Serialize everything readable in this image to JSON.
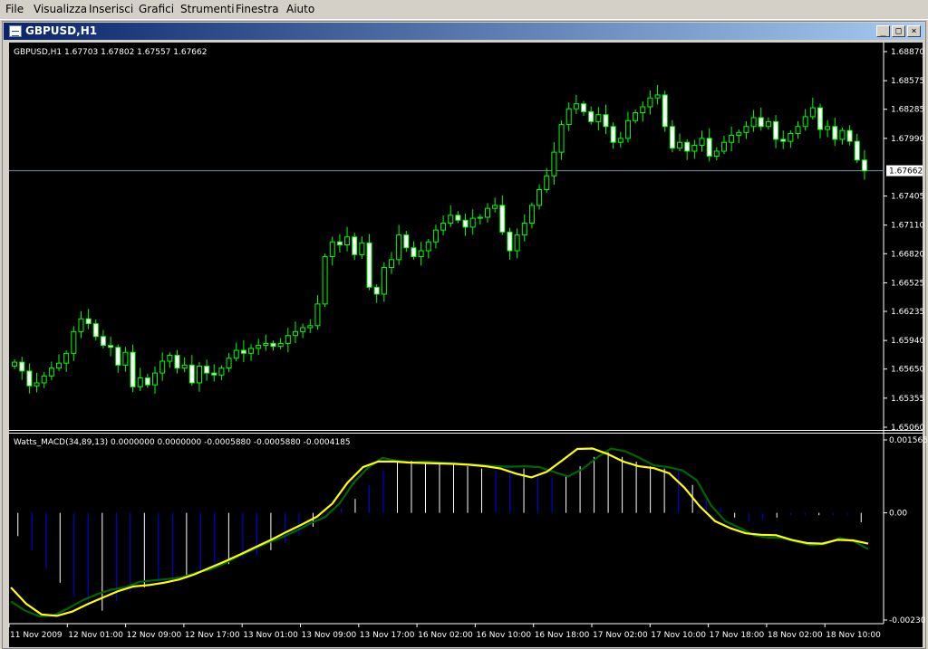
{
  "menu": [
    "File",
    "Visualizza",
    "Inserisci",
    "Grafici",
    "Strumenti",
    "Finestra",
    "Aiuto"
  ],
  "window": {
    "title": "GBPUSD,H1",
    "minimize": "_",
    "restore": "□",
    "close": "×"
  },
  "colors": {
    "background": "#000000",
    "candle_bull_fill": "#000000",
    "candle_bear_fill": "#ffffff",
    "candle_outline": "#00ff00",
    "grid_line": "#7f8ca8",
    "macd_line": "#006400",
    "signal_line": "#ffff00",
    "histogram_positive": "#ffffff",
    "histogram_negative": "#0000ff"
  },
  "chart_data": [
    {
      "type": "candlestick",
      "title": "GBPUSD,H1  1.67703 1.67802 1.67557 1.67662",
      "symbol": "GBPUSD",
      "timeframe": "H1",
      "last_ohlc": {
        "open": 1.67703,
        "high": 1.67802,
        "low": 1.67557,
        "close": 1.67662
      },
      "current_price_label": "1.67662",
      "y_ticks": [
        "1.68870",
        "1.68575",
        "1.68285",
        "1.67990",
        "1.67405",
        "1.67110",
        "1.66820",
        "1.66525",
        "1.66235",
        "1.65940",
        "1.65650",
        "1.65355",
        "1.65060"
      ],
      "ylim": [
        1.6506,
        1.6887
      ],
      "x_ticks": [
        "11 Nov 2009",
        "12 Nov 01:00",
        "12 Nov 09:00",
        "12 Nov 17:00",
        "13 Nov 01:00",
        "13 Nov 09:00",
        "13 Nov 17:00",
        "16 Nov 02:00",
        "16 Nov 10:00",
        "16 Nov 18:00",
        "17 Nov 02:00",
        "17 Nov 10:00",
        "17 Nov 18:00",
        "18 Nov 02:00",
        "18 Nov 10:00"
      ],
      "close_series": [
        1.6572,
        1.6563,
        1.6548,
        1.6551,
        1.6558,
        1.6566,
        1.6571,
        1.6581,
        1.6603,
        1.6616,
        1.6611,
        1.6598,
        1.6589,
        1.6587,
        1.6569,
        1.6582,
        1.6547,
        1.6556,
        1.6549,
        1.6561,
        1.6573,
        1.6579,
        1.6566,
        1.6569,
        1.6551,
        1.6568,
        1.6561,
        1.6559,
        1.6566,
        1.6576,
        1.6584,
        1.6581,
        1.6586,
        1.6589,
        1.6591,
        1.6588,
        1.6591,
        1.6599,
        1.6603,
        1.6607,
        1.6609,
        1.6631,
        1.6679,
        1.6694,
        1.6691,
        1.6699,
        1.6681,
        1.6693,
        1.6648,
        1.6641,
        1.6668,
        1.6676,
        1.6701,
        1.6688,
        1.6679,
        1.6685,
        1.6694,
        1.6706,
        1.6713,
        1.6721,
        1.6716,
        1.6709,
        1.6718,
        1.6719,
        1.6728,
        1.6731,
        1.6704,
        1.6685,
        1.6701,
        1.6713,
        1.6731,
        1.6747,
        1.6761,
        1.6785,
        1.6813,
        1.6829,
        1.6834,
        1.6826,
        1.6816,
        1.6823,
        1.6811,
        1.6795,
        1.6799,
        1.6817,
        1.6825,
        1.6831,
        1.684,
        1.6843,
        1.6811,
        1.6789,
        1.6795,
        1.6786,
        1.6792,
        1.6799,
        1.6781,
        1.6786,
        1.6795,
        1.6802,
        1.6805,
        1.6811,
        1.682,
        1.6811,
        1.6816,
        1.6798,
        1.6796,
        1.6804,
        1.6811,
        1.6821,
        1.683,
        1.6808,
        1.6811,
        1.6798,
        1.6807,
        1.6796,
        1.6777,
        1.6766
      ]
    },
    {
      "type": "line",
      "title": "Watts_MACD(34,89,13) 0.0000000 0.0000000 -0.0005880 -0.0005880 -0.0004185",
      "y_ticks": [
        "0.001565",
        "0.00",
        "-0.00230"
      ],
      "ylim": [
        -0.0023,
        0.001565
      ],
      "series": [
        {
          "name": "Watts_MACD",
          "color": "#006400",
          "values": [
            -0.0019,
            -0.0021,
            -0.00222,
            -0.0022,
            -0.00205,
            -0.00188,
            -0.00175,
            -0.00165,
            -0.0016,
            -0.00148,
            -0.00145,
            -0.00142,
            -0.00138,
            -0.00128,
            -0.00121,
            -0.00108,
            -0.00092,
            -0.00078,
            -0.00064,
            -0.00052,
            -0.00038,
            -0.00022,
            -9e-05,
            0.0002,
            0.00065,
            0.00097,
            0.00118,
            0.00112,
            0.00108,
            0.0011,
            0.00108,
            0.00106,
            0.00104,
            0.00102,
            0.001,
            0.00099,
            0.001,
            0.00098,
            0.00088,
            0.00078,
            0.00094,
            0.00118,
            0.00138,
            0.00132,
            0.00118,
            0.00102,
            0.00098,
            0.00091,
            0.0007,
            0.00016,
            -0.00018,
            -0.00032,
            -0.00048,
            -0.00053,
            -0.00054,
            -0.00062,
            -0.00069,
            -0.00067,
            -0.00054,
            -0.00061,
            -0.00078
          ]
        },
        {
          "name": "Signal",
          "color": "#ffff00",
          "values": [
            -0.0016,
            -0.00195,
            -0.00218,
            -0.00221,
            -0.00212,
            -0.00196,
            -0.00182,
            -0.00168,
            -0.00158,
            -0.00155,
            -0.0015,
            -0.00143,
            -0.00132,
            -0.00118,
            -0.00104,
            -0.00089,
            -0.00073,
            -0.00058,
            -0.00041,
            -0.00025,
            -8e-05,
            0.0002,
            0.00065,
            0.00098,
            0.0011,
            0.0011,
            0.00108,
            0.00107,
            0.00106,
            0.00105,
            0.00103,
            0.001,
            0.00095,
            0.00084,
            0.00076,
            0.00088,
            0.00112,
            0.00137,
            0.00138,
            0.00126,
            0.0011,
            0.001,
            0.00096,
            0.00085,
            0.00054,
            0.00014,
            -0.00018,
            -0.00033,
            -0.00044,
            -0.00047,
            -0.00048,
            -0.00058,
            -0.00065,
            -0.00066,
            -0.00058,
            -0.00059,
            -0.00066
          ]
        }
      ],
      "histogram": {
        "positive_color": "#ffffff",
        "negative_color": "#0000ff",
        "values": [
          -0.0005,
          -0.0008,
          -0.0012,
          -0.0015,
          -0.0018,
          -0.002,
          -0.0021,
          -0.0019,
          -0.0017,
          -0.0016,
          -0.0015,
          -0.00145,
          -0.0014,
          -0.0013,
          -0.0012,
          -0.0011,
          -0.001,
          -0.0009,
          -0.0008,
          -0.00065,
          -0.0005,
          -0.0003,
          -0.0001,
          0.0001,
          0.0003,
          0.0006,
          0.0009,
          0.0011,
          0.00112,
          0.0011,
          0.00108,
          0.00105,
          0.001,
          0.00095,
          0.0009,
          0.0009,
          0.00095,
          0.00085,
          0.00075,
          0.0008,
          0.001,
          0.0012,
          0.0013,
          0.0012,
          0.0011,
          0.001,
          0.00095,
          0.0009,
          0.0006,
          0.0003,
          0.0001,
          -0.0001,
          -0.0002,
          -0.00015,
          -0.0001,
          -5e-05,
          -5e-05,
          -5e-05,
          -5e-05,
          -5e-05,
          -0.0002
        ]
      }
    }
  ]
}
